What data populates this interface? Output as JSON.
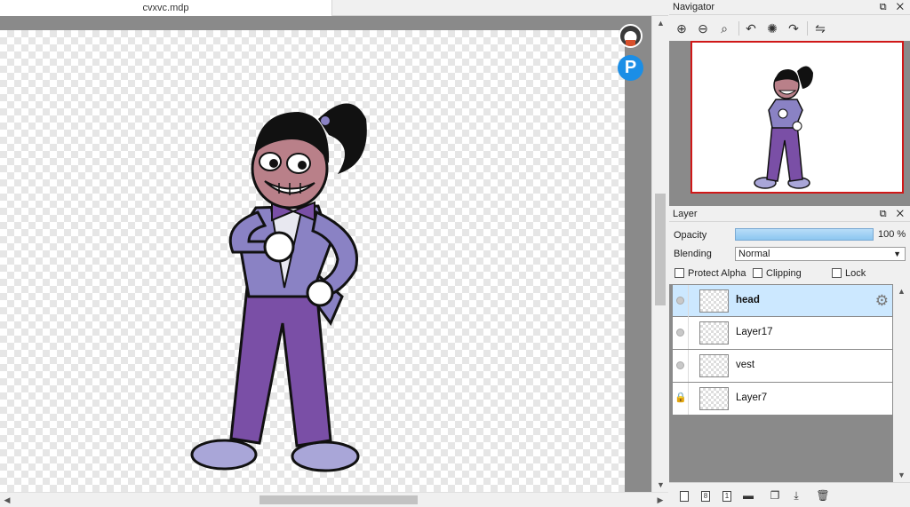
{
  "document": {
    "tab_title": "cvxvc.mdp"
  },
  "canvas": {
    "p_badge": "P"
  },
  "navigator": {
    "title": "Navigator",
    "header_buttons": "⧉ ✕",
    "tools": [
      {
        "name": "zoom-in-icon",
        "glyph": "⊕"
      },
      {
        "name": "zoom-out-icon",
        "glyph": "⊖"
      },
      {
        "name": "zoom-reset-icon",
        "glyph": "⌕"
      },
      {
        "name": "rotate-left-icon",
        "glyph": "↶"
      },
      {
        "name": "rotate-reset-icon",
        "glyph": "✺"
      },
      {
        "name": "rotate-right-icon",
        "glyph": "↷"
      },
      {
        "name": "flip-horizontal-icon",
        "glyph": "⇋"
      }
    ]
  },
  "layer_panel": {
    "title": "Layer",
    "header_buttons": "⧉ ✕",
    "opacity_label": "Opacity",
    "opacity_value": "100 %",
    "opacity_level": 1.0,
    "blending_label": "Blending",
    "blending_value": "Normal",
    "protect_alpha_label": "Protect Alpha",
    "clipping_label": "Clipping",
    "lock_label": "Lock",
    "layers": [
      {
        "name": "head",
        "selected": true,
        "locked": false
      },
      {
        "name": "Layer17",
        "selected": false,
        "locked": false
      },
      {
        "name": "vest",
        "selected": false,
        "locked": false
      },
      {
        "name": "Layer7",
        "selected": false,
        "locked": true
      }
    ]
  },
  "colors": {
    "selection": "#cce8ff",
    "opacity_bar": "#8cc6f0",
    "navigator_frame": "#d01818",
    "p_badge": "#1b8ee6",
    "suit": "#8a82c4",
    "pants": "#7a4fa6",
    "skin": "#b98089"
  }
}
